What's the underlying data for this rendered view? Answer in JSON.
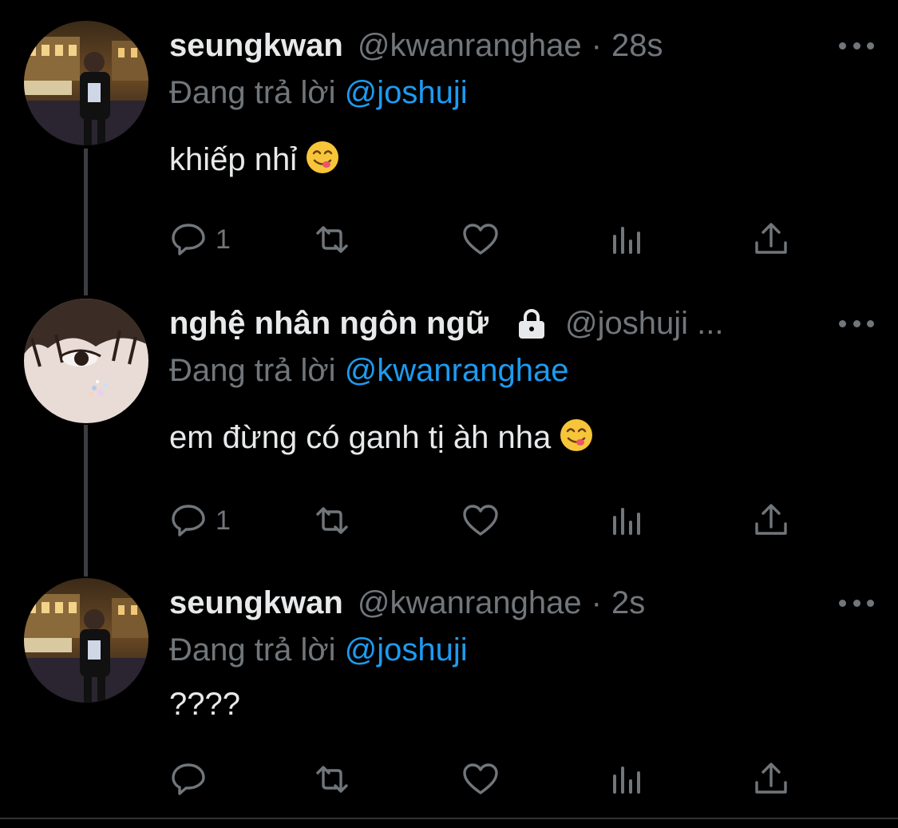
{
  "tweets": [
    {
      "name": "seungkwan",
      "handle": "@kwanranghae",
      "dot": "·",
      "time": "28s",
      "reply_prefix": "Đang trả lời",
      "reply_to": "@joshuji",
      "text": "khiếp nhỉ",
      "emoji": "face-savoring-food",
      "reply_count": "1"
    },
    {
      "name": "nghệ nhân ngôn ngữ",
      "locked": true,
      "handle": "@joshuji ...",
      "reply_prefix": "Đang trả lời",
      "reply_to": "@kwanranghae",
      "text": "em đừng có ganh tị àh nha",
      "emoji": "face-savoring-food",
      "reply_count": "1"
    },
    {
      "name": "seungkwan",
      "handle": "@kwanranghae",
      "dot": "·",
      "time": "2s",
      "reply_prefix": "Đang trả lời",
      "reply_to": "@joshuji",
      "text": "????",
      "reply_count": ""
    }
  ],
  "icons": {
    "reply": "reply-icon",
    "retweet": "retweet-icon",
    "like": "heart-icon",
    "views": "views-icon",
    "share": "share-icon",
    "more": "more-icon",
    "lock": "lock-icon"
  },
  "colors": {
    "background": "#000000",
    "text": "#e7e9ea",
    "secondary": "#71767b",
    "link": "#1d9bf0",
    "thread_line": "#3a3d41"
  }
}
